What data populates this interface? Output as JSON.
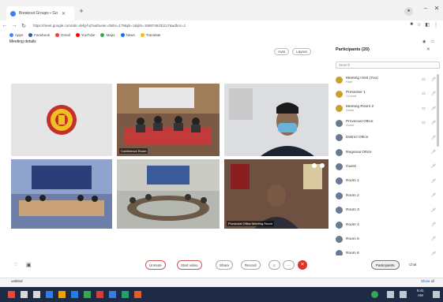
{
  "browser": {
    "tab_title": "Breakout Groups • Go",
    "url": "https://meet.google.com/abc-defg-hij?authuser=0&hs=179&pli=1&ijlm=1698748431117&adhoc=1",
    "bookmarks": [
      {
        "label": "Apps",
        "color": "#4285f4"
      },
      {
        "label": "Facebook",
        "color": "#3b5998"
      },
      {
        "label": "Gmail",
        "color": "#ea4335"
      },
      {
        "label": "YouTube",
        "color": "#ff0000"
      },
      {
        "label": "Maps",
        "color": "#34a853"
      },
      {
        "label": "News",
        "color": "#1a73e8"
      },
      {
        "label": "Translate",
        "color": "#fbbc04"
      }
    ]
  },
  "meeting": {
    "title": "Meeting details",
    "view_controls": [
      "Auto",
      "Layout"
    ],
    "tile_labels": [
      "",
      "Conference Room",
      "",
      "",
      "",
      "Provincial Office Meeting Room"
    ]
  },
  "participants_panel": {
    "title": "Participants (20)",
    "search_placeholder": "Search",
    "participants": [
      {
        "name": "Meeting Host (You)",
        "sub": "Host",
        "color": "#c8a12b"
      },
      {
        "name": "Presenter 1",
        "sub": "Co-host",
        "color": "#c8a12b"
      },
      {
        "name": "Meeting Room 2",
        "sub": "Guest",
        "color": "#c8a12b"
      },
      {
        "name": "Provincial Office",
        "sub": "Guest",
        "color": "#6a7a94"
      },
      {
        "name": "District Office",
        "sub": "",
        "color": "#6a7a94"
      },
      {
        "name": "Regional Office",
        "sub": "",
        "color": "#6a7a94"
      },
      {
        "name": "Guest",
        "sub": "",
        "color": "#6a7a94"
      },
      {
        "name": "Room 1",
        "sub": "",
        "color": "#6a7a94"
      },
      {
        "name": "Room 2",
        "sub": "",
        "color": "#6a7a94"
      },
      {
        "name": "Room 3",
        "sub": "",
        "color": "#6a7a94"
      },
      {
        "name": "Room 4",
        "sub": "",
        "color": "#6a7a94"
      },
      {
        "name": "Room 5",
        "sub": "",
        "color": "#6a7a94"
      },
      {
        "name": "Room 6",
        "sub": "",
        "color": "#6a7a94"
      }
    ]
  },
  "toolbar": {
    "mute_label": "Unmute",
    "video_label": "Start video",
    "share_label": "Share",
    "record_label": "Record",
    "participants_label": "Participants",
    "chat_label": "Chat"
  },
  "download_bar": {
    "file_name": "untitled",
    "show_all": "Show all"
  },
  "taskbar": {
    "time": "9:41",
    "date": "AM"
  },
  "colors": {
    "end_call": "#e0312d",
    "taskbar": "#1f2a44"
  }
}
